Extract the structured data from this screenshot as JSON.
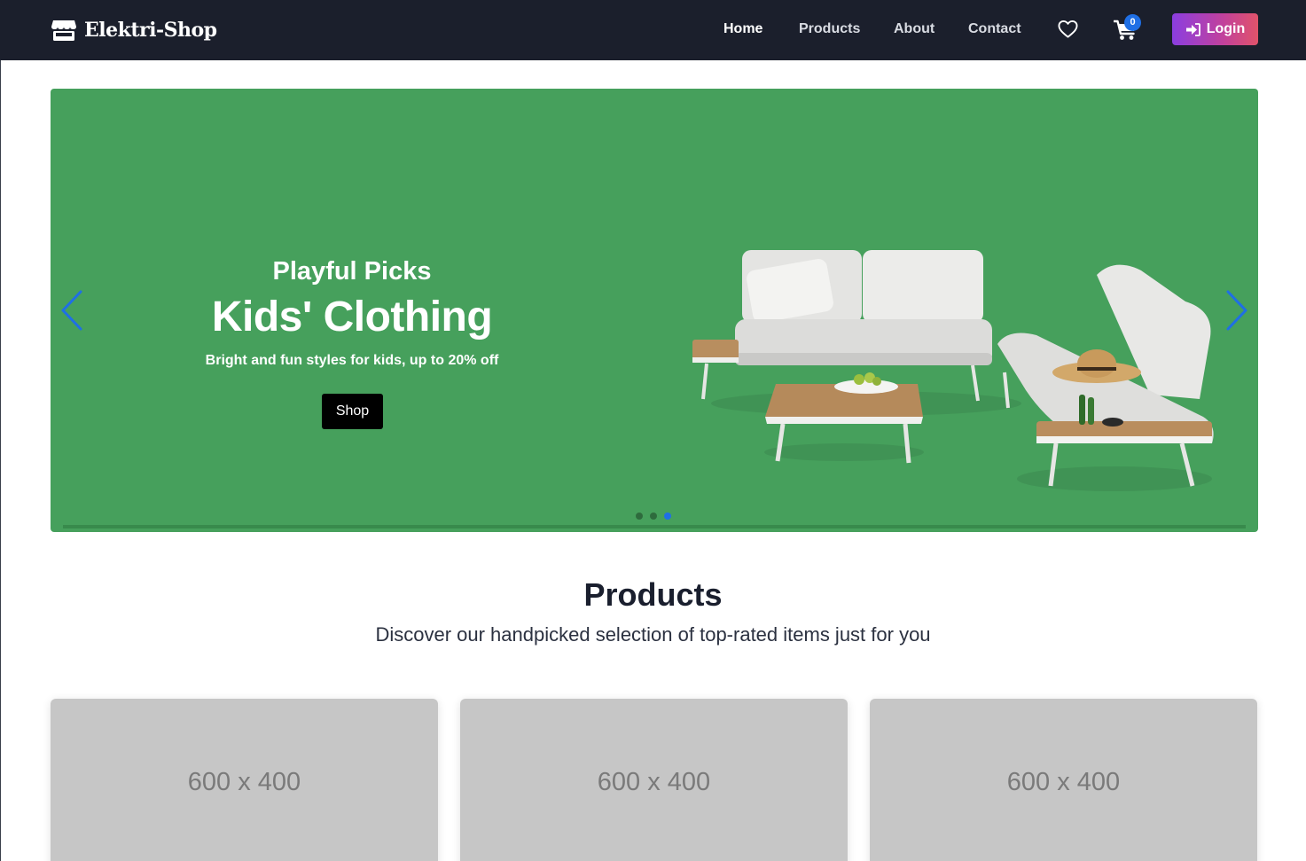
{
  "brand": {
    "name": "Elektri-Shop",
    "icon": "store-icon"
  },
  "nav": {
    "links": [
      "Home",
      "Products",
      "About",
      "Contact"
    ],
    "active": "Home",
    "wishlist_icon": "heart-icon",
    "cart_icon": "cart-icon",
    "cart_count": "0",
    "login_label": "Login",
    "login_icon": "sign-in-icon"
  },
  "hero": {
    "subtitle": "Playful Picks",
    "title": "Kids' Clothing",
    "description": "Bright and fun styles for kids, up to 20% off",
    "cta_label": "Shop",
    "background": "#46a05c",
    "slides": 3,
    "active_slide": 3
  },
  "products": {
    "title": "Products",
    "subtitle": "Discover our handpicked selection of top-rated items just for you",
    "cards": [
      {
        "placeholder": "600 x 400"
      },
      {
        "placeholder": "600 x 400"
      },
      {
        "placeholder": "600 x 400"
      }
    ]
  },
  "colors": {
    "navbar": "#1b1f2c",
    "accent": "#1f6fe5",
    "login_gradient": [
      "#8b3ee0",
      "#e1536a"
    ]
  }
}
